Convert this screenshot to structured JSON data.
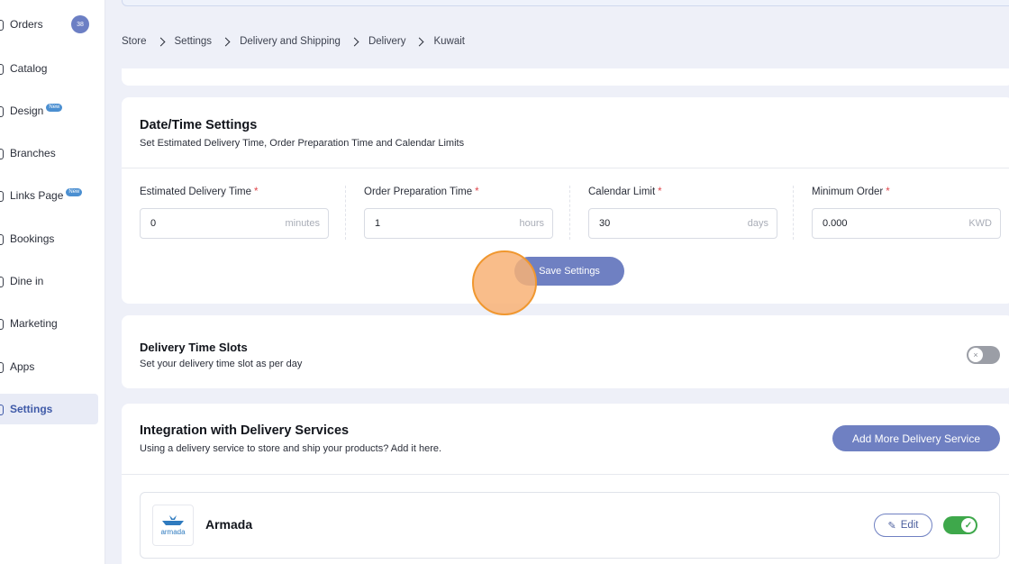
{
  "sidebar": {
    "items": [
      {
        "label": "Orders",
        "badge": "38"
      },
      {
        "label": "Catalog"
      },
      {
        "label": "Design",
        "tag": "New"
      },
      {
        "label": "Branches"
      },
      {
        "label": "Links Page",
        "tag": "New"
      },
      {
        "label": "Bookings"
      },
      {
        "label": "Dine in"
      },
      {
        "label": "Marketing"
      },
      {
        "label": "Apps"
      },
      {
        "label": "Settings",
        "active": true
      }
    ]
  },
  "breadcrumb": [
    "Store",
    "Settings",
    "Delivery and Shipping",
    "Delivery",
    "Kuwait"
  ],
  "datetime": {
    "title": "Date/Time Settings",
    "subtitle": "Set Estimated Delivery Time, Order Preparation Time and Calendar Limits",
    "fields": [
      {
        "label": "Estimated Delivery Time",
        "required": "*",
        "value": "0",
        "unit": "minutes"
      },
      {
        "label": "Order Preparation Time",
        "required": "*",
        "value": "1",
        "unit": "hours"
      },
      {
        "label": "Calendar Limit",
        "required": "*",
        "value": "30",
        "unit": "days"
      },
      {
        "label": "Minimum Order",
        "required": "*",
        "value": "0.000",
        "unit": "KWD"
      }
    ],
    "save_label": "Save Settings"
  },
  "slots": {
    "title": "Delivery Time Slots",
    "subtitle": "Set your delivery time slot as per day",
    "enabled": false,
    "toggle_icon": "×"
  },
  "integration": {
    "title": "Integration with Delivery Services",
    "subtitle": "Using a delivery service to store and ship your products? Add it here.",
    "add_label": "Add More Delivery Service",
    "services": [
      {
        "name": "Armada",
        "logo_text": "armada",
        "edit_label": "Edit",
        "edit_icon": "✎",
        "enabled": true,
        "toggle_icon": "✓"
      }
    ]
  },
  "colors": {
    "primary": "#6f80c2",
    "toggle_on": "#3ea84b",
    "required": "#e0474c",
    "click_highlight": "#f8b276"
  }
}
